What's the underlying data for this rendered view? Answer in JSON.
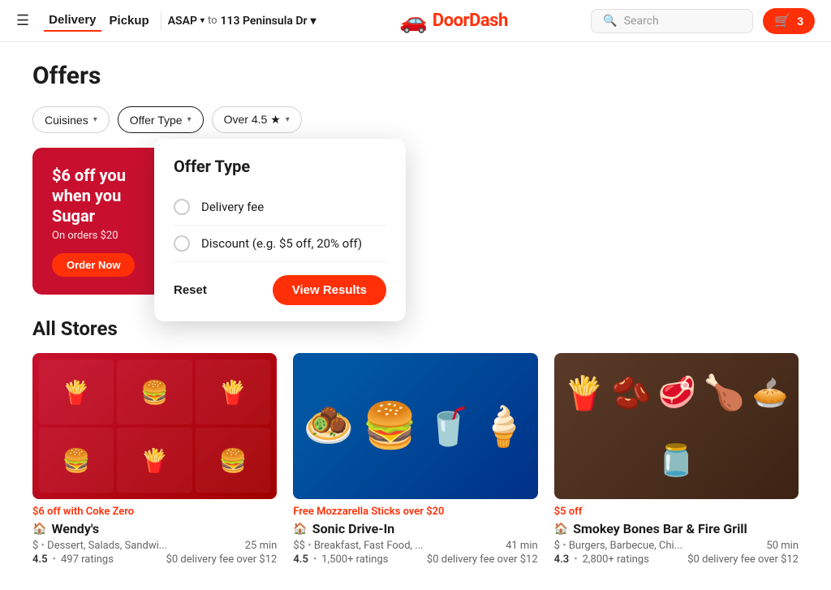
{
  "header": {
    "menu_label": "☰",
    "delivery_label": "Delivery",
    "pickup_label": "Pickup",
    "asap_label": "ASAP",
    "asap_chevron": "▾",
    "to_label": "to",
    "address_label": "113 Peninsula Dr",
    "address_chevron": "▾",
    "logo_icon": "🚗",
    "logo_text": "DoorDash",
    "search_placeholder": "Search",
    "cart_icon": "🛒",
    "cart_count": "3"
  },
  "filters": {
    "cuisines_label": "Cuisines",
    "offer_type_label": "Offer Type",
    "rating_label": "Over 4.5 ★"
  },
  "dropdown": {
    "title": "Offer Type",
    "options": [
      {
        "id": "delivery_fee",
        "label": "Delivery fee",
        "selected": false
      },
      {
        "id": "discount",
        "label": "Discount (e.g. $5 off, 20% off)",
        "selected": false
      }
    ],
    "reset_label": "Reset",
    "view_results_label": "View Results"
  },
  "promo": {
    "title_line1": "$6 off you",
    "title_line2": "when you",
    "title_line3": "Sugar",
    "sub_text": "On orders $20",
    "order_btn": "Order Now"
  },
  "all_stores": {
    "section_title": "All Stores",
    "stores": [
      {
        "offer": "$6 off with Coke Zero",
        "name": "Wendy's",
        "price_range": "$",
        "categories": "Dessert, Salads, Sandwi...",
        "time": "25 min",
        "rating": "4.5",
        "ratings_count": "497 ratings",
        "delivery_fee": "$0 delivery fee over $12"
      },
      {
        "offer": "Free Mozzarella Sticks over $20",
        "name": "Sonic Drive-In",
        "price_range": "$$",
        "categories": "Breakfast, Fast Food, ...",
        "time": "41 min",
        "rating": "4.5",
        "ratings_count": "1,500+ ratings",
        "delivery_fee": "$0 delivery fee over $12"
      },
      {
        "offer": "$5 off",
        "name": "Smokey Bones Bar & Fire Grill",
        "price_range": "$",
        "categories": "Burgers, Barbecue, Chi...",
        "time": "50 min",
        "rating": "4.3",
        "ratings_count": "2,800+ ratings",
        "delivery_fee": "$0 delivery fee over $12"
      }
    ]
  }
}
